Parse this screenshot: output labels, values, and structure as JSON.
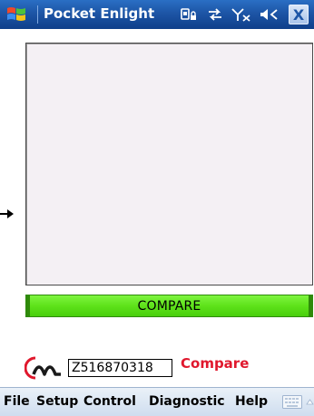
{
  "window": {
    "title": "Pocket Enlight",
    "close_label": "X",
    "icons": [
      "start-flag-icon",
      "secure-device-icon",
      "connectivity-icon",
      "antenna-off-icon",
      "volume-muted-icon"
    ]
  },
  "main": {
    "compare_button_label": "COMPARE",
    "serial_value": "Z516870318",
    "compare_link_label": "Compare"
  },
  "menu": {
    "items": [
      "File",
      "Setup",
      "Control",
      "Diagnostic",
      "Help"
    ],
    "icons": [
      "keyboard-icon",
      "input-arrow-icon"
    ]
  },
  "colors": {
    "titlebar": "#1d55a6",
    "compare_bar": "#5ee21a",
    "compare_link": "#e0182d",
    "preview_bg": "#f4f0f4",
    "menubar": "#cfddef"
  }
}
